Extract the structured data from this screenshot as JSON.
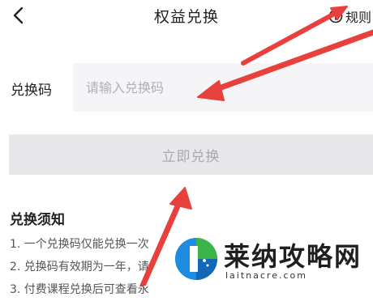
{
  "header": {
    "title": "权益兑换",
    "rules_label": "规则",
    "back_icon": "chevron-left-icon",
    "rules_icon": "info-circle-icon"
  },
  "form": {
    "code_label": "兑换码",
    "code_placeholder": "请输入兑换码",
    "code_value": ""
  },
  "redeem_button": {
    "label": "立即兑换",
    "state": "disabled"
  },
  "notice": {
    "title": "兑换须知",
    "items": [
      "1. 一个兑换码仅能兑换一次",
      "2. 兑换码有效期为一年，请",
      "3. 付费课程兑换后可查看永"
    ]
  },
  "annotation": {
    "arrow_color": "#e8403c"
  },
  "watermark": {
    "title": "莱纳攻略网",
    "url": "laitnacre.com"
  },
  "colors": {
    "input_bg": "#f5f5f7",
    "button_bg": "#e8e8ea",
    "button_text": "#a9a9ad",
    "placeholder": "#b0b0b6"
  }
}
